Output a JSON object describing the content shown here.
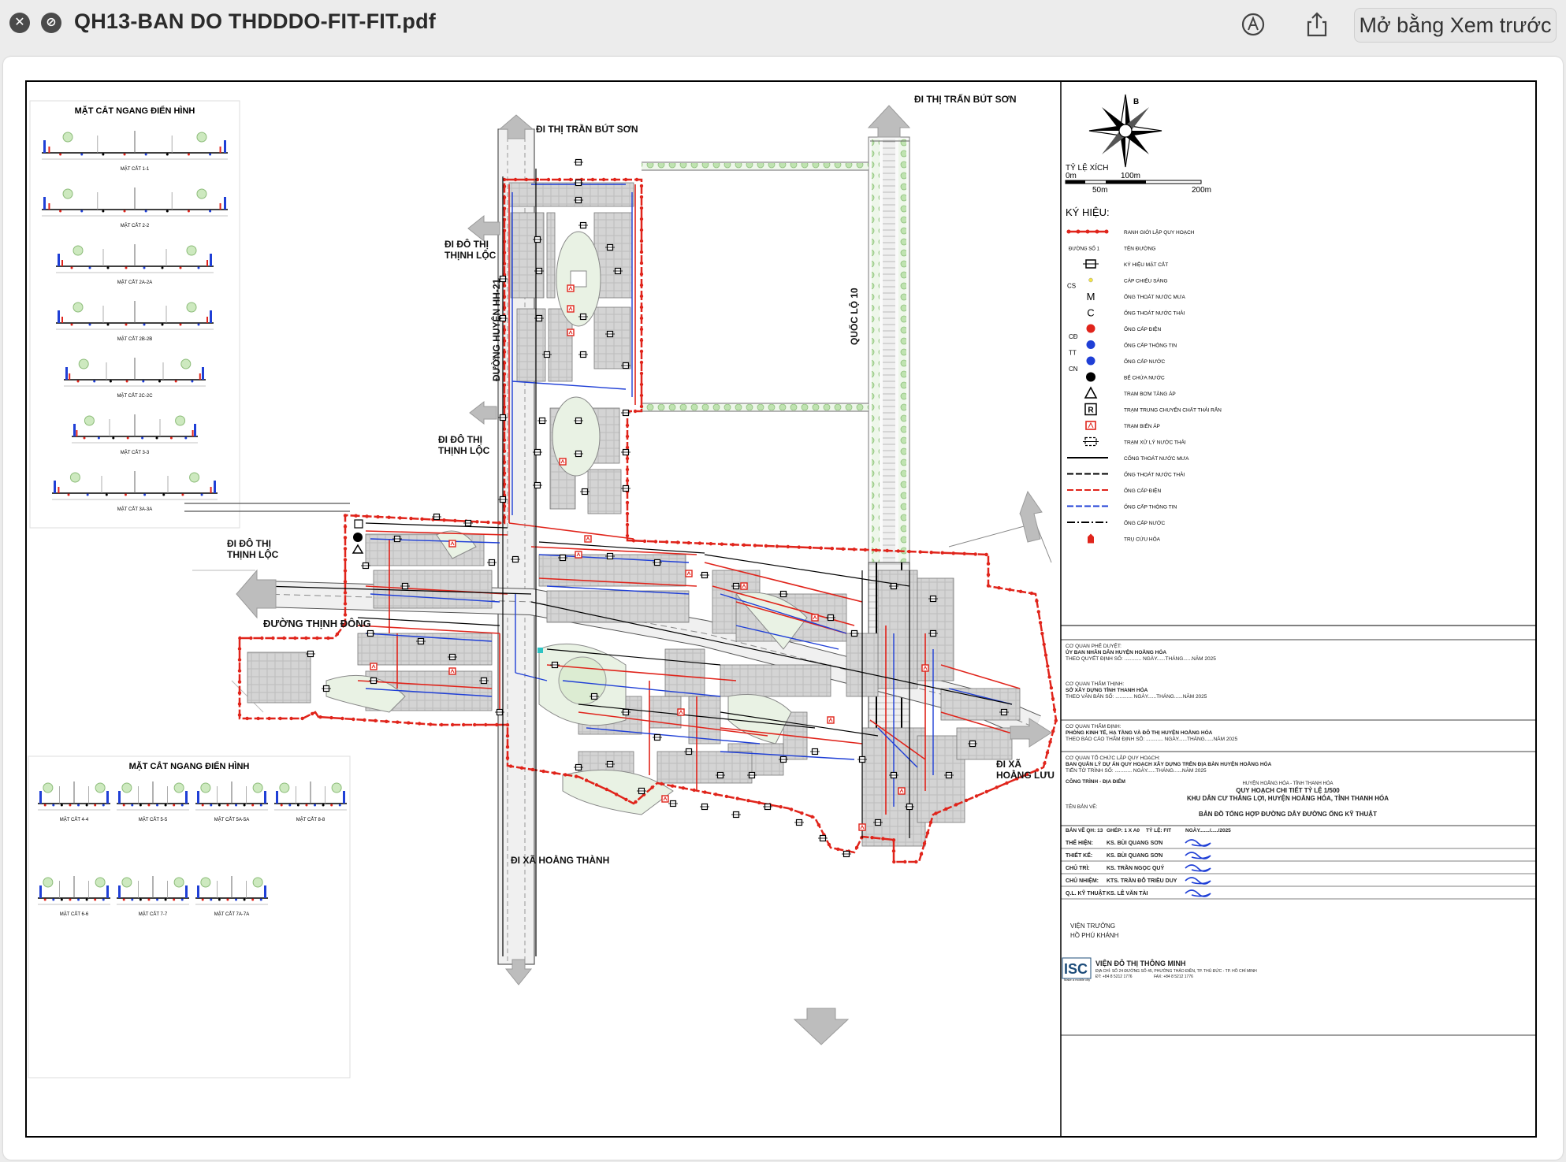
{
  "window": {
    "title": "QH13-BAN DO THDDDO-FIT-FIT.pdf",
    "open_button": "Mở bằng Xem trước",
    "icons": [
      "close-icon",
      "block-icon",
      "markup-pen-icon",
      "share-icon"
    ]
  },
  "map": {
    "directions": {
      "north_top": "ĐI THỊ TRẤN BÚT SƠN",
      "north_center": "ĐI THỊ TRẦN BÚT SƠN",
      "west_upper": "ĐI ĐÔ THỊ\nTHỊNH LỘC",
      "west_middle": "ĐI ĐÔ THỊ\nTHỊNH LỘC",
      "west_lower": "ĐI ĐÔ THỊ\nTHỊNH LỘC",
      "south": "ĐI XÃ HOẰNG THÀNH",
      "east": "ĐI XÃ\nHOẰNG LƯU"
    },
    "roads": {
      "vertical": "ĐƯỜNG HUYỆN HH-21",
      "highway": "QUỐC LỘ 10",
      "horizontal": "ĐƯỜNG THỊNH ĐÔNG"
    }
  },
  "sections_top": {
    "title": "MẶT CẮT NGANG ĐIỂN HÌNH",
    "items": [
      "MẶT CẮT 1-1",
      "MẶT CẮT 2-2",
      "MẶT CẮT 2A-2A",
      "MẶT CẮT 2B-2B",
      "MẶT CẮT 2C-2C",
      "MẶT CẮT 3-3",
      "MẶT CẮT 3A-3A"
    ]
  },
  "sections_bottom": {
    "title": "MẶT CẮT NGANG ĐIỂN HÌNH",
    "items": [
      "MẶT CẮT 4-4",
      "MẶT CẮT 5-5",
      "MẶT CẮT 5A-5A",
      "MẶT CẮT 8-8",
      "MẶT CẮT 6-6",
      "MẶT CẮT 7-7",
      "MẶT CẮT 7A-7A"
    ]
  },
  "legend": {
    "north_letter": "B",
    "scale_title": "TỶ LỆ XÍCH",
    "scale_labels": [
      "0m",
      "50m",
      "100m",
      "200m"
    ],
    "title": "KÝ HIỆU:",
    "items": [
      {
        "label": "RANH GIỚI LẬP QUY HOẠCH",
        "symbol": "boundary"
      },
      {
        "label": "TÊN ĐƯỜNG",
        "symbol": "ĐƯỜNG SỐ 1"
      },
      {
        "label": "KÝ HIỆU MẶT CẮT",
        "symbol": "section"
      },
      {
        "label": "CÁP CHIẾU SÁNG",
        "symbol": "CS"
      },
      {
        "label": "ỐNG THOÁT NƯỚC MƯA",
        "symbol": "M"
      },
      {
        "label": "ỐNG THOÁT NƯỚC THẢI",
        "symbol": "C"
      },
      {
        "label": "ỐNG CẤP ĐIỆN",
        "symbol": "CĐ"
      },
      {
        "label": "ỐNG CẤP THÔNG TIN",
        "symbol": "TT"
      },
      {
        "label": "ỐNG CẤP NƯỚC",
        "symbol": "CN"
      },
      {
        "label": "BỂ CHỨA NƯỚC",
        "symbol": "tank"
      },
      {
        "label": "TRẠM BƠM TĂNG ÁP",
        "symbol": "pump"
      },
      {
        "label": "TRẠM TRUNG CHUYỂN CHẤT THẢI RẮN",
        "symbol": "R"
      },
      {
        "label": "TRẠM BIẾN ÁP",
        "symbol": "transformer"
      },
      {
        "label": "TRẠM XỬ LÝ NƯỚC THẢI",
        "symbol": "wastewater"
      },
      {
        "label": "CỐNG THOÁT NƯỚC MƯA",
        "symbol": "line-black"
      },
      {
        "label": "ỐNG THOÁT NƯỚC THẢI",
        "symbol": "line-dash"
      },
      {
        "label": "ỐNG CẤP ĐIỆN",
        "symbol": "line-red"
      },
      {
        "label": "ỐNG CẤP THÔNG TIN",
        "symbol": "line-blue"
      },
      {
        "label": "ỐNG CẤP NƯỚC",
        "symbol": "line-mixed"
      },
      {
        "label": "TRỤ CỨU HỎA",
        "symbol": "hydrant"
      }
    ]
  },
  "titleblock": {
    "approval": {
      "head": "CƠ QUAN PHÊ DUYỆT:",
      "org": "ỦY BAN NHÂN DÂN HUYỆN HOẰNG HÓA",
      "line": "THEO QUYẾT ĐỊNH SỐ: ............ NGÀY......THÁNG......NĂM 2025"
    },
    "appraisal": {
      "head": "CƠ QUAN THẨM THỊNH:",
      "org": "SỞ XÂY DỰNG TỈNH THANH HÓA",
      "line": "THEO VĂN BẢN SỐ: ............ NGÀY......THÁNG......NĂM 2025"
    },
    "review": {
      "head": "CƠ QUAN THẨM ĐỊNH:",
      "org": "PHÒNG KINH TẾ, HẠ TẦNG VÀ ĐÔ THỊ HUYỆN HOẰNG HÓA",
      "line": "THEO BÁO CÁO THẨM ĐỊNH SỐ: ............ NGÀY......THÁNG......NĂM 2025"
    },
    "organizer": {
      "head": "CƠ QUAN TỔ CHỨC LẬP QUY HOẠCH:",
      "org": "BAN QUẢN LÝ DỰ ÁN QUY HOẠCH XÂY DỰNG TRÊN ĐỊA BÀN HUYỆN HOẰNG HÓA",
      "line": "TIẾN TỜ TRÌNH SỐ: ............ NGÀY......THÁNG......NĂM 2025"
    },
    "project": {
      "head": "CÔNG TRÌNH - ĐỊA ĐIỂM",
      "location": "HUYỆN HOẰNG HÓA - TỈNH THANH HÓA",
      "name1": "QUY HOẠCH CHI TIẾT TỶ LỆ 1/500",
      "name2": "KHU DÂN CƯ THẮNG LỢI, HUYỆN HOẰNG HÓA, TỈNH THANH HÓA",
      "drawing_head": "TÊN BẢN VẼ:",
      "drawing": "BẢN ĐỒ TỔNG HỢP ĐƯỜNG DÂY ĐƯỜNG ỐNG KỸ THUẬT"
    },
    "meta": {
      "sheet": "BẢN VẼ QH: 13",
      "paper": "GHÉP: 1 X A0",
      "scale": "TỶ LỆ: FIT",
      "date": "NGÀY......./...../2025"
    },
    "people": [
      {
        "role": "THỂ HIỆN:",
        "name": "KS. BÙI QUANG SƠN"
      },
      {
        "role": "THIẾT KẾ:",
        "name": "KS. BÙI QUANG SƠN"
      },
      {
        "role": "CHỦ TRÌ:",
        "name": "KS. TRẦN NGỌC QUÝ"
      },
      {
        "role": "CHỦ NHIỆM:",
        "name": "KTS. TRẦN ĐỖ TRIỀU DUY"
      },
      {
        "role": "Q.L. KỸ THUẬT",
        "name": "KS. LÊ VĂN TÀI"
      }
    ],
    "director": {
      "role": "VIỆN TRƯỞNG",
      "name": "HỒ PHÚ KHÁNH"
    },
    "firm": {
      "logo": "ISC",
      "name": "VIỆN ĐÔ THỊ THÔNG MINH",
      "tagline": "Make a mobile city",
      "address": "ĐỊA CHỈ: SỐ 24 ĐƯỜNG SỐ 45, PHƯỜNG THẢO ĐIỀN, TP. THỦ ĐỨC - TP. HỒ CHÍ MINH",
      "phone": "ĐT: +84 8 5212 1776",
      "fax": "FAX: +84 8 5212 1776"
    }
  },
  "colors": {
    "boundary": "#e0241b",
    "power": "#e0241b",
    "telecom": "#1f3fd6",
    "water": "#1f3fd6",
    "drain": "#000000",
    "block": "#d2d2d2",
    "green": "#b9e3a8"
  }
}
